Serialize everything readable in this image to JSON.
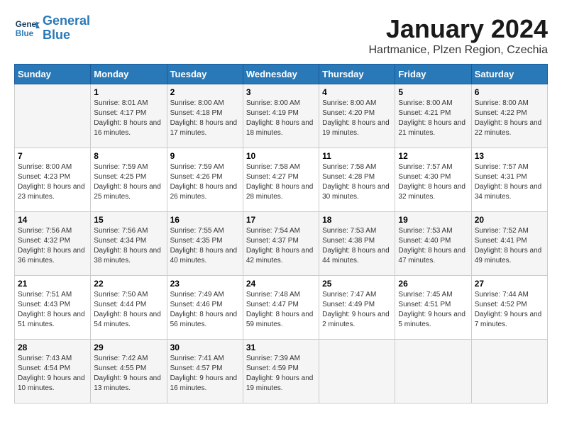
{
  "header": {
    "logo_line1": "General",
    "logo_line2": "Blue",
    "month": "January 2024",
    "location": "Hartmanice, Plzen Region, Czechia"
  },
  "weekdays": [
    "Sunday",
    "Monday",
    "Tuesday",
    "Wednesday",
    "Thursday",
    "Friday",
    "Saturday"
  ],
  "weeks": [
    [
      {
        "day": "",
        "sunrise": "",
        "sunset": "",
        "daylight": ""
      },
      {
        "day": "1",
        "sunrise": "Sunrise: 8:01 AM",
        "sunset": "Sunset: 4:17 PM",
        "daylight": "Daylight: 8 hours and 16 minutes."
      },
      {
        "day": "2",
        "sunrise": "Sunrise: 8:00 AM",
        "sunset": "Sunset: 4:18 PM",
        "daylight": "Daylight: 8 hours and 17 minutes."
      },
      {
        "day": "3",
        "sunrise": "Sunrise: 8:00 AM",
        "sunset": "Sunset: 4:19 PM",
        "daylight": "Daylight: 8 hours and 18 minutes."
      },
      {
        "day": "4",
        "sunrise": "Sunrise: 8:00 AM",
        "sunset": "Sunset: 4:20 PM",
        "daylight": "Daylight: 8 hours and 19 minutes."
      },
      {
        "day": "5",
        "sunrise": "Sunrise: 8:00 AM",
        "sunset": "Sunset: 4:21 PM",
        "daylight": "Daylight: 8 hours and 21 minutes."
      },
      {
        "day": "6",
        "sunrise": "Sunrise: 8:00 AM",
        "sunset": "Sunset: 4:22 PM",
        "daylight": "Daylight: 8 hours and 22 minutes."
      }
    ],
    [
      {
        "day": "7",
        "sunrise": "Sunrise: 8:00 AM",
        "sunset": "Sunset: 4:23 PM",
        "daylight": "Daylight: 8 hours and 23 minutes."
      },
      {
        "day": "8",
        "sunrise": "Sunrise: 7:59 AM",
        "sunset": "Sunset: 4:25 PM",
        "daylight": "Daylight: 8 hours and 25 minutes."
      },
      {
        "day": "9",
        "sunrise": "Sunrise: 7:59 AM",
        "sunset": "Sunset: 4:26 PM",
        "daylight": "Daylight: 8 hours and 26 minutes."
      },
      {
        "day": "10",
        "sunrise": "Sunrise: 7:58 AM",
        "sunset": "Sunset: 4:27 PM",
        "daylight": "Daylight: 8 hours and 28 minutes."
      },
      {
        "day": "11",
        "sunrise": "Sunrise: 7:58 AM",
        "sunset": "Sunset: 4:28 PM",
        "daylight": "Daylight: 8 hours and 30 minutes."
      },
      {
        "day": "12",
        "sunrise": "Sunrise: 7:57 AM",
        "sunset": "Sunset: 4:30 PM",
        "daylight": "Daylight: 8 hours and 32 minutes."
      },
      {
        "day": "13",
        "sunrise": "Sunrise: 7:57 AM",
        "sunset": "Sunset: 4:31 PM",
        "daylight": "Daylight: 8 hours and 34 minutes."
      }
    ],
    [
      {
        "day": "14",
        "sunrise": "Sunrise: 7:56 AM",
        "sunset": "Sunset: 4:32 PM",
        "daylight": "Daylight: 8 hours and 36 minutes."
      },
      {
        "day": "15",
        "sunrise": "Sunrise: 7:56 AM",
        "sunset": "Sunset: 4:34 PM",
        "daylight": "Daylight: 8 hours and 38 minutes."
      },
      {
        "day": "16",
        "sunrise": "Sunrise: 7:55 AM",
        "sunset": "Sunset: 4:35 PM",
        "daylight": "Daylight: 8 hours and 40 minutes."
      },
      {
        "day": "17",
        "sunrise": "Sunrise: 7:54 AM",
        "sunset": "Sunset: 4:37 PM",
        "daylight": "Daylight: 8 hours and 42 minutes."
      },
      {
        "day": "18",
        "sunrise": "Sunrise: 7:53 AM",
        "sunset": "Sunset: 4:38 PM",
        "daylight": "Daylight: 8 hours and 44 minutes."
      },
      {
        "day": "19",
        "sunrise": "Sunrise: 7:53 AM",
        "sunset": "Sunset: 4:40 PM",
        "daylight": "Daylight: 8 hours and 47 minutes."
      },
      {
        "day": "20",
        "sunrise": "Sunrise: 7:52 AM",
        "sunset": "Sunset: 4:41 PM",
        "daylight": "Daylight: 8 hours and 49 minutes."
      }
    ],
    [
      {
        "day": "21",
        "sunrise": "Sunrise: 7:51 AM",
        "sunset": "Sunset: 4:43 PM",
        "daylight": "Daylight: 8 hours and 51 minutes."
      },
      {
        "day": "22",
        "sunrise": "Sunrise: 7:50 AM",
        "sunset": "Sunset: 4:44 PM",
        "daylight": "Daylight: 8 hours and 54 minutes."
      },
      {
        "day": "23",
        "sunrise": "Sunrise: 7:49 AM",
        "sunset": "Sunset: 4:46 PM",
        "daylight": "Daylight: 8 hours and 56 minutes."
      },
      {
        "day": "24",
        "sunrise": "Sunrise: 7:48 AM",
        "sunset": "Sunset: 4:47 PM",
        "daylight": "Daylight: 8 hours and 59 minutes."
      },
      {
        "day": "25",
        "sunrise": "Sunrise: 7:47 AM",
        "sunset": "Sunset: 4:49 PM",
        "daylight": "Daylight: 9 hours and 2 minutes."
      },
      {
        "day": "26",
        "sunrise": "Sunrise: 7:45 AM",
        "sunset": "Sunset: 4:51 PM",
        "daylight": "Daylight: 9 hours and 5 minutes."
      },
      {
        "day": "27",
        "sunrise": "Sunrise: 7:44 AM",
        "sunset": "Sunset: 4:52 PM",
        "daylight": "Daylight: 9 hours and 7 minutes."
      }
    ],
    [
      {
        "day": "28",
        "sunrise": "Sunrise: 7:43 AM",
        "sunset": "Sunset: 4:54 PM",
        "daylight": "Daylight: 9 hours and 10 minutes."
      },
      {
        "day": "29",
        "sunrise": "Sunrise: 7:42 AM",
        "sunset": "Sunset: 4:55 PM",
        "daylight": "Daylight: 9 hours and 13 minutes."
      },
      {
        "day": "30",
        "sunrise": "Sunrise: 7:41 AM",
        "sunset": "Sunset: 4:57 PM",
        "daylight": "Daylight: 9 hours and 16 minutes."
      },
      {
        "day": "31",
        "sunrise": "Sunrise: 7:39 AM",
        "sunset": "Sunset: 4:59 PM",
        "daylight": "Daylight: 9 hours and 19 minutes."
      },
      {
        "day": "",
        "sunrise": "",
        "sunset": "",
        "daylight": ""
      },
      {
        "day": "",
        "sunrise": "",
        "sunset": "",
        "daylight": ""
      },
      {
        "day": "",
        "sunrise": "",
        "sunset": "",
        "daylight": ""
      }
    ]
  ]
}
